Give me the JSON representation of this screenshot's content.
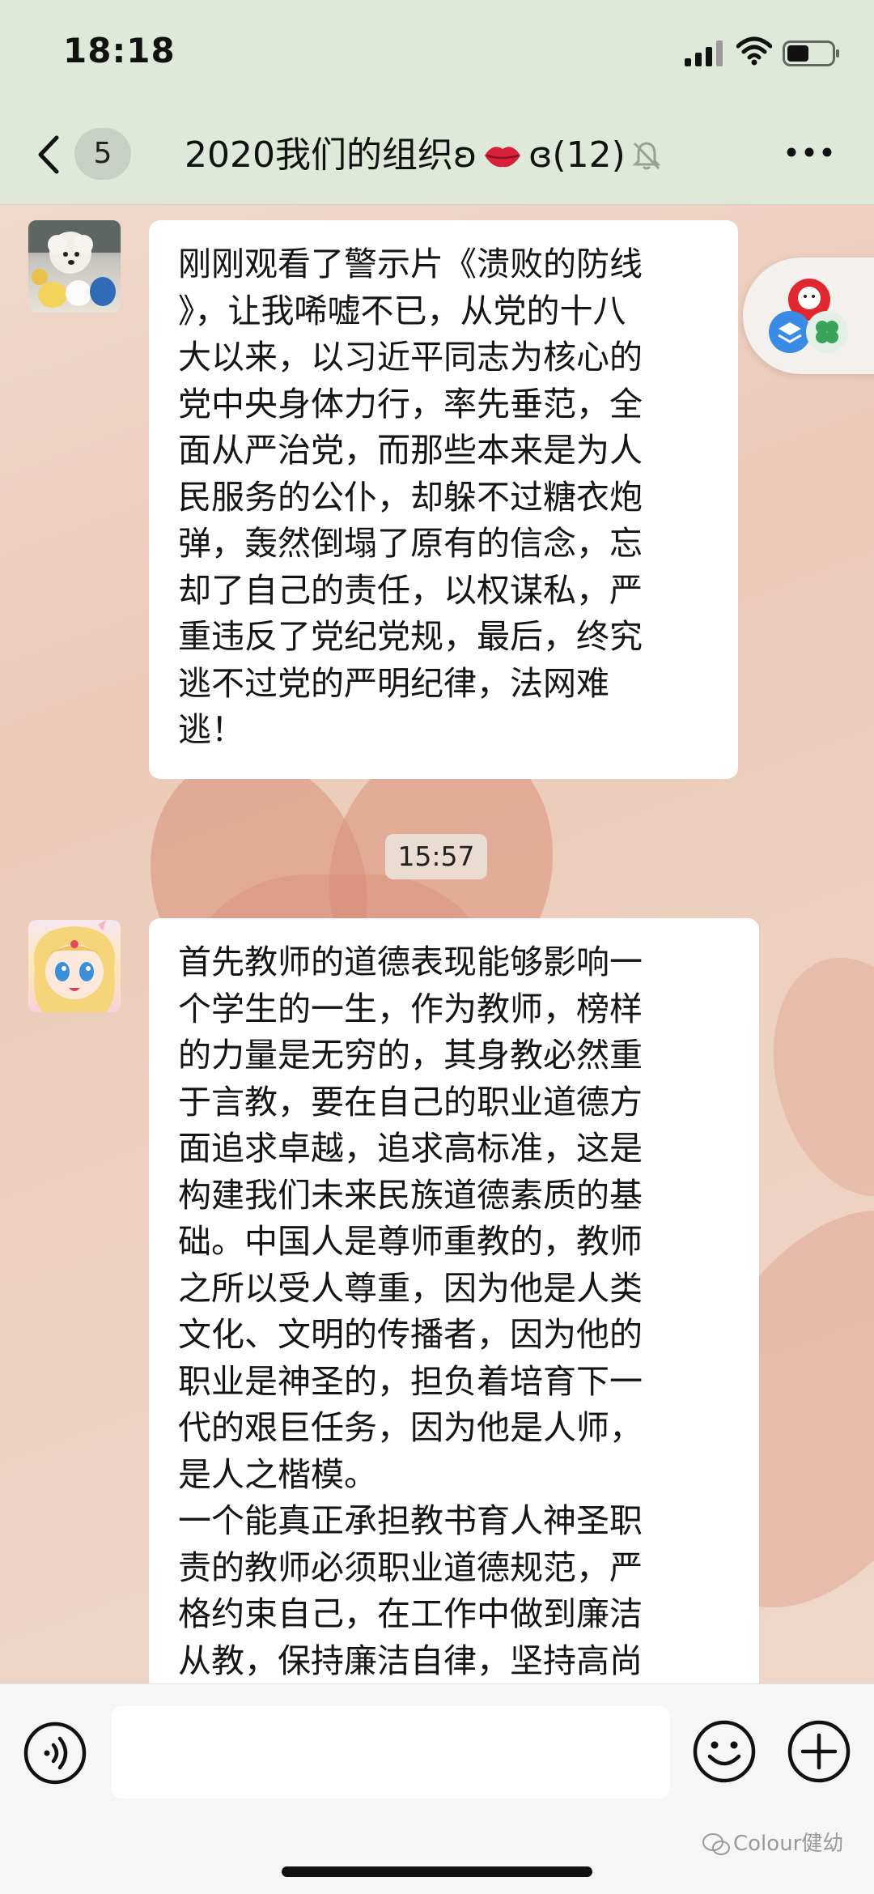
{
  "status_bar": {
    "time": "18:18"
  },
  "nav": {
    "unread_count": "5",
    "title_prefix": "2020我们的组织ʚ",
    "title_suffix": "ɞ(12)",
    "icons": [
      "back-icon",
      "lips-icon",
      "mute-bell-icon",
      "more-icon"
    ]
  },
  "messages": [
    {
      "avatar": "poodle-dog-avatar",
      "text": "刚刚观看了警示片《溃败的防线\n》，让我唏嘘不已，从党的十八\n大以来，以习近平同志为核心的\n党中央身体力行，率先垂范，全\n面从严治党，而那些本来是为人\n民服务的公仆，却躲不过糖衣炮\n弹，轰然倒塌了原有的信念，忘\n却了自己的责任，以权谋私，严\n重违反了党纪党规，最后，终究\n逃不过党的严明纪律，法网难\n逃！"
    },
    {
      "avatar": "anime-girl-avatar",
      "text": "首先教师的道德表现能够影响一\n个学生的一生，作为教师，榜样\n的力量是无穷的，其身教必然重\n于言教，要在自己的职业道德方\n面追求卓越，追求高标准，这是\n构建我们未来民族道德素质的基\n础。中国人是尊师重教的，教师\n之所以受人尊重，因为他是人类\n文化、文明的传播者，因为他的\n职业是神圣的，担负着培育下一\n代的艰巨任务，因为他是人师，\n是人之楷模。\n一个能真正承担教书育人神圣职\n责的教师必须职业道德规范，严\n格约束自己，在工作中做到廉洁\n从教，保持廉洁自律，坚持高尚"
    }
  ],
  "timestamp": "15:57",
  "float_widget": {
    "icons": [
      "kfc-app-icon",
      "stack-app-icon",
      "clover-app-icon"
    ]
  },
  "input_bar": {
    "placeholder": "",
    "icons": [
      "voice-icon",
      "emoji-icon",
      "add-icon"
    ]
  },
  "watermark": "Colour健幼",
  "colors": {
    "nav_background": "#dfe9d9",
    "bubble_background": "#ffffff",
    "input_bar_background": "#f6f6f6",
    "wallpaper": "#eccab8"
  }
}
